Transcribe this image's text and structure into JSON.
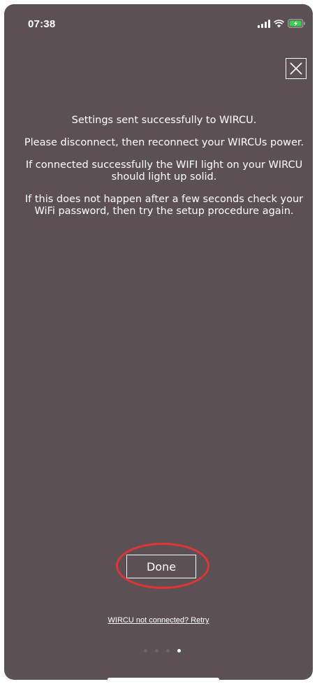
{
  "status_bar": {
    "time": "07:38",
    "icons": [
      "signal-icon",
      "wifi-icon",
      "battery-charging-icon"
    ],
    "battery_color": "#3ccf4e"
  },
  "close_icon": "close-icon",
  "message": {
    "line1": "Settings sent successfully to WIRCU.",
    "line2": "Please disconnect, then reconnect your WIRCUs power.",
    "line3": "If connected successfully the WIFI light on your WIRCU should light up solid.",
    "line4": "If this does not happen after a few seconds check your WiFi password, then try the setup procedure again."
  },
  "done_button_label": "Done",
  "highlight_color": "#e23434",
  "retry_link_label": "WIRCU not connected? Retry",
  "pagination": {
    "total": 4,
    "current": 4
  },
  "colors": {
    "background": "#5b5155",
    "text": "#ffffff"
  }
}
